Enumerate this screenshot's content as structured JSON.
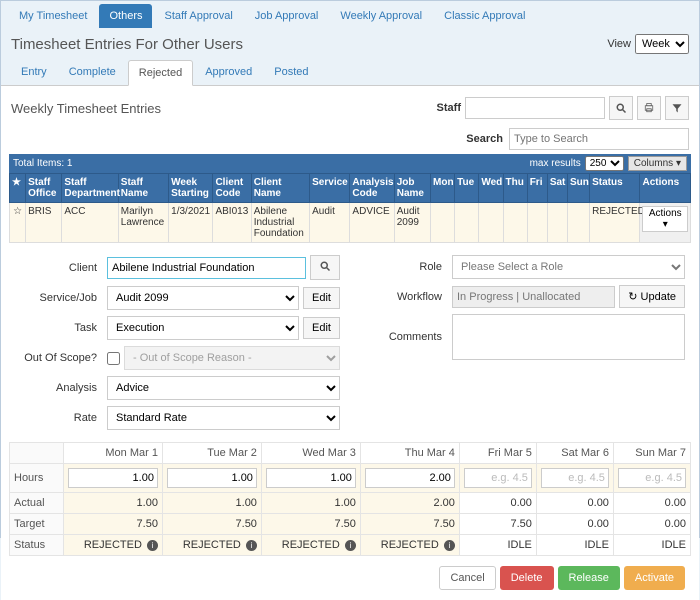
{
  "nav": {
    "items": [
      {
        "label": "My Timesheet"
      },
      {
        "label": "Others",
        "active": true
      },
      {
        "label": "Staff Approval"
      },
      {
        "label": "Job Approval"
      },
      {
        "label": "Weekly Approval"
      },
      {
        "label": "Classic Approval"
      }
    ]
  },
  "title": "Timesheet Entries For Other Users",
  "view": {
    "label": "View",
    "selected": "Week"
  },
  "subnav": {
    "items": [
      {
        "label": "Entry"
      },
      {
        "label": "Complete"
      },
      {
        "label": "Rejected",
        "active": true
      },
      {
        "label": "Approved"
      },
      {
        "label": "Posted"
      }
    ]
  },
  "panel": {
    "title": "Weekly Timesheet Entries",
    "staff_label": "Staff",
    "search_label": "Search",
    "search_placeholder": "Type to Search"
  },
  "gridbar": {
    "total": "Total Items: 1",
    "max_label": "max results",
    "max_value": "250",
    "columns": "Columns"
  },
  "grid": {
    "headers": [
      "Staff Office",
      "Staff Department",
      "Staff Name",
      "Week Starting",
      "Client Code",
      "Client Name",
      "Service",
      "Analysis Code",
      "Job Name",
      "Mon",
      "Tue",
      "Wed",
      "Thu",
      "Fri",
      "Sat",
      "Sun",
      "Status",
      "Actions"
    ],
    "row": {
      "office": "BRIS",
      "dept": "ACC",
      "name": "Marilyn Lawrence",
      "week": "1/3/2021",
      "ccode": "ABI013",
      "cname": "Abilene Industrial Foundation",
      "service": "Audit",
      "analysis": "ADVICE",
      "job": "Audit 2099",
      "status": "REJECTED",
      "actions": "Actions"
    }
  },
  "form": {
    "client_label": "Client",
    "client_value": "Abilene Industrial Foundation",
    "service_label": "Service/Job",
    "service_value": "Audit 2099",
    "edit": "Edit",
    "task_label": "Task",
    "task_value": "Execution",
    "oos_label": "Out Of Scope?",
    "oos_reason": " - Out of Scope Reason - ",
    "analysis_label": "Analysis",
    "analysis_value": "Advice",
    "rate_label": "Rate",
    "rate_value": "Standard Rate",
    "role_label": "Role",
    "role_value": "Please Select a Role",
    "wf_label": "Workflow",
    "wf_value": "In Progress | Unallocated",
    "update": "Update",
    "comments_label": "Comments"
  },
  "days": {
    "headers": [
      "Mon Mar 1",
      "Tue Mar 2",
      "Wed Mar 3",
      "Thu Mar 4",
      "Fri Mar 5",
      "Sat Mar 6",
      "Sun Mar 7"
    ],
    "rows": {
      "hours": {
        "label": "Hours",
        "vals": [
          "1.00",
          "1.00",
          "1.00",
          "2.00",
          "",
          "",
          ""
        ],
        "ph": "e.g. 4.5"
      },
      "actual": {
        "label": "Actual",
        "vals": [
          "1.00",
          "1.00",
          "1.00",
          "2.00",
          "0.00",
          "0.00",
          "0.00"
        ]
      },
      "target": {
        "label": "Target",
        "vals": [
          "7.50",
          "7.50",
          "7.50",
          "7.50",
          "7.50",
          "0.00",
          "0.00"
        ]
      },
      "status": {
        "label": "Status",
        "vals": [
          "REJECTED",
          "REJECTED",
          "REJECTED",
          "REJECTED",
          "IDLE",
          "IDLE",
          "IDLE"
        ]
      }
    }
  },
  "footer": {
    "cancel": "Cancel",
    "delete": "Delete",
    "release": "Release",
    "activate": "Activate"
  }
}
